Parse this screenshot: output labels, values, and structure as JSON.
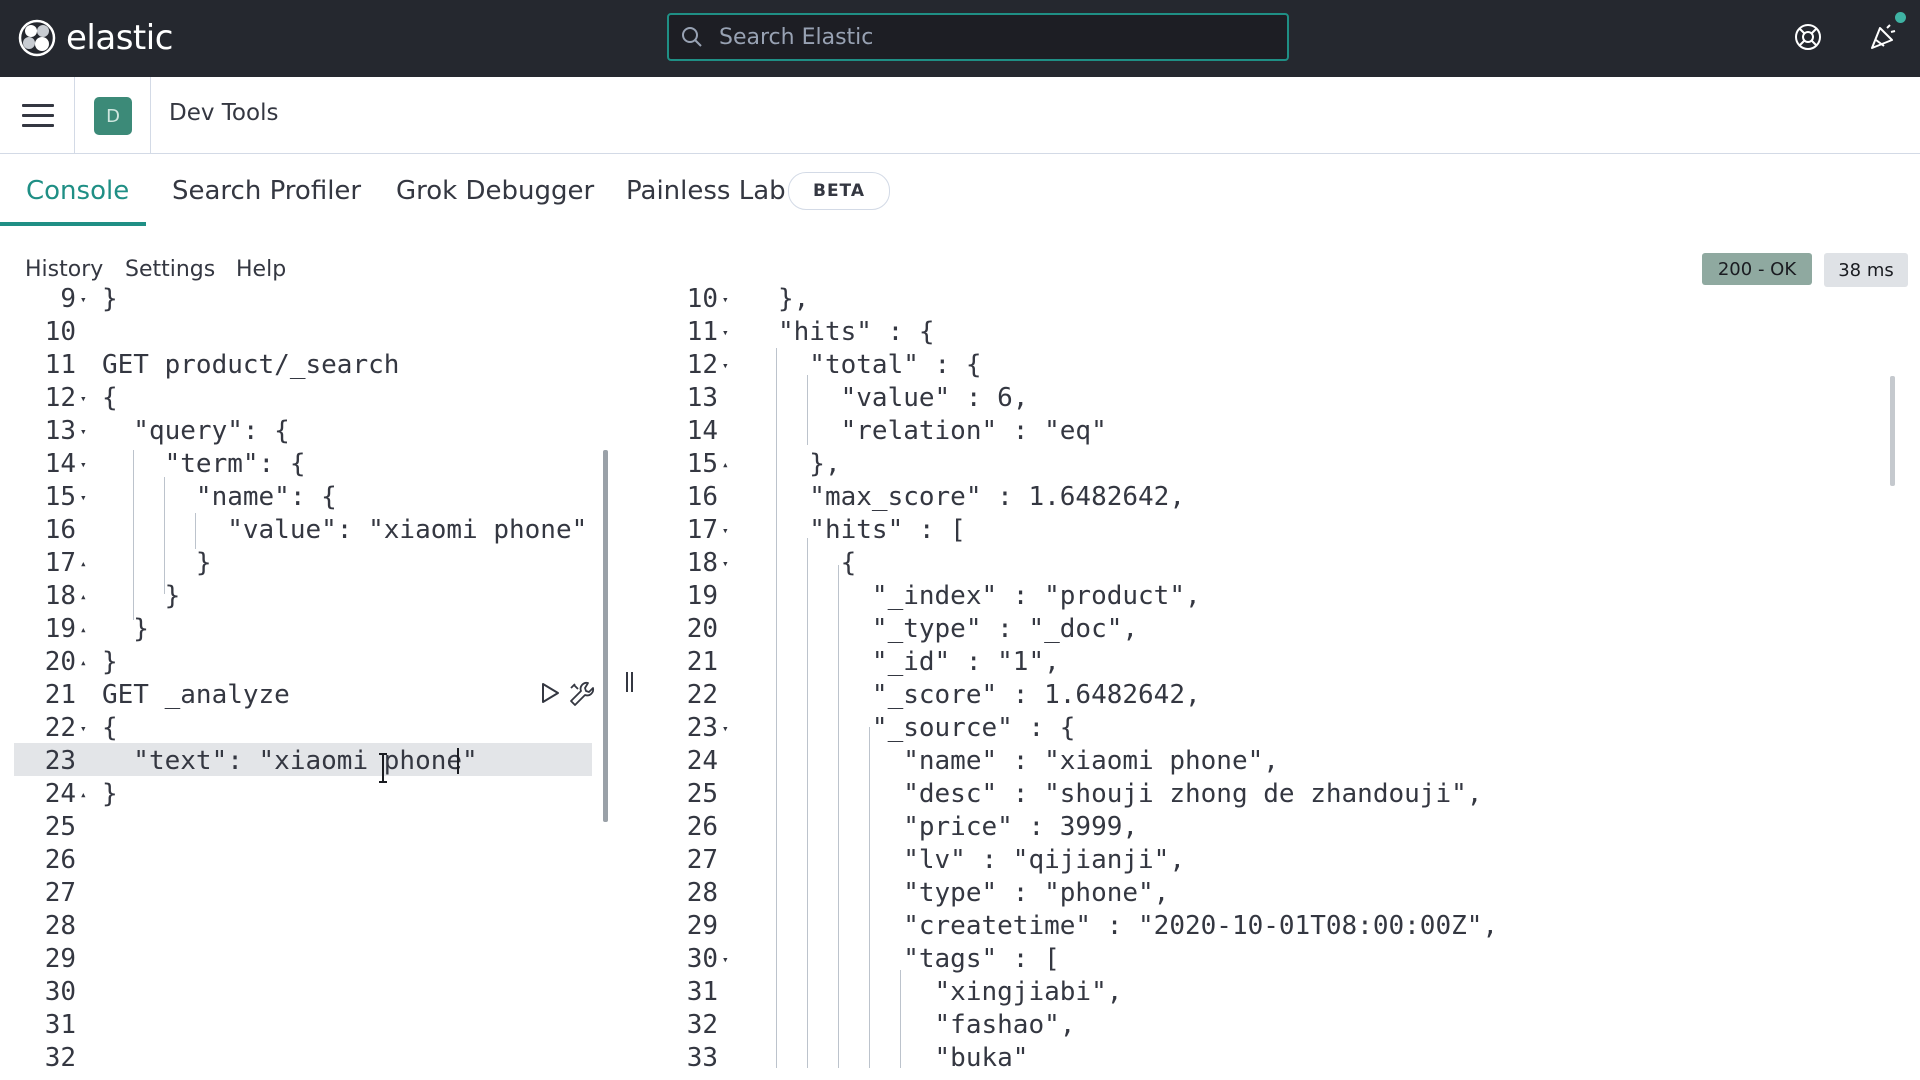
{
  "header": {
    "brand": "elastic",
    "search_placeholder": "Search Elastic"
  },
  "breadcrumb": {
    "space_initial": "D",
    "title": "Dev Tools"
  },
  "tabs": [
    {
      "label": "Console",
      "active": true
    },
    {
      "label": "Search Profiler",
      "active": false
    },
    {
      "label": "Grok Debugger",
      "active": false
    },
    {
      "label": "Painless Lab",
      "active": false
    }
  ],
  "beta_badge": "BETA",
  "console_menu": {
    "history": "History",
    "settings": "Settings",
    "help": "Help"
  },
  "response_status": {
    "status": "200 - OK",
    "time": "38 ms"
  },
  "request_editor": {
    "lines": [
      {
        "n": "9",
        "fold": "▾",
        "text": "}"
      },
      {
        "n": "10",
        "fold": "",
        "text": ""
      },
      {
        "n": "11",
        "fold": "",
        "text": "GET product/_search"
      },
      {
        "n": "12",
        "fold": "▾",
        "text": "{"
      },
      {
        "n": "13",
        "fold": "▾",
        "text": "  \"query\": {"
      },
      {
        "n": "14",
        "fold": "▾",
        "text": "    \"term\": {"
      },
      {
        "n": "15",
        "fold": "▾",
        "text": "      \"name\": {"
      },
      {
        "n": "16",
        "fold": "",
        "text": "        \"value\": \"xiaomi phone\""
      },
      {
        "n": "17",
        "fold": "▴",
        "text": "      }"
      },
      {
        "n": "18",
        "fold": "▴",
        "text": "    }"
      },
      {
        "n": "19",
        "fold": "▴",
        "text": "  }"
      },
      {
        "n": "20",
        "fold": "▴",
        "text": "}"
      },
      {
        "n": "21",
        "fold": "",
        "text": "GET _analyze"
      },
      {
        "n": "22",
        "fold": "▾",
        "text": "{"
      },
      {
        "n": "23",
        "fold": "",
        "text": "  \"text\": \"xiaomi phone\""
      },
      {
        "n": "24",
        "fold": "▴",
        "text": "}"
      },
      {
        "n": "25",
        "fold": "",
        "text": ""
      },
      {
        "n": "26",
        "fold": "",
        "text": ""
      },
      {
        "n": "27",
        "fold": "",
        "text": ""
      },
      {
        "n": "28",
        "fold": "",
        "text": ""
      },
      {
        "n": "29",
        "fold": "",
        "text": ""
      },
      {
        "n": "30",
        "fold": "",
        "text": ""
      },
      {
        "n": "31",
        "fold": "",
        "text": ""
      },
      {
        "n": "32",
        "fold": "",
        "text": ""
      }
    ]
  },
  "response_editor": {
    "lines": [
      {
        "n": "10",
        "fold": "▾",
        "text": "},"
      },
      {
        "n": "11",
        "fold": "▾",
        "text": "\"hits\" : {"
      },
      {
        "n": "12",
        "fold": "▾",
        "text": "  \"total\" : {"
      },
      {
        "n": "13",
        "fold": "",
        "text": "    \"value\" : 6,"
      },
      {
        "n": "14",
        "fold": "",
        "text": "    \"relation\" : \"eq\""
      },
      {
        "n": "15",
        "fold": "▴",
        "text": "  },"
      },
      {
        "n": "16",
        "fold": "",
        "text": "  \"max_score\" : 1.6482642,"
      },
      {
        "n": "17",
        "fold": "▾",
        "text": "  \"hits\" : ["
      },
      {
        "n": "18",
        "fold": "▾",
        "text": "    {"
      },
      {
        "n": "19",
        "fold": "",
        "text": "      \"_index\" : \"product\","
      },
      {
        "n": "20",
        "fold": "",
        "text": "      \"_type\" : \"_doc\","
      },
      {
        "n": "21",
        "fold": "",
        "text": "      \"_id\" : \"1\","
      },
      {
        "n": "22",
        "fold": "",
        "text": "      \"_score\" : 1.6482642,"
      },
      {
        "n": "23",
        "fold": "▾",
        "text": "      \"_source\" : {"
      },
      {
        "n": "24",
        "fold": "",
        "text": "        \"name\" : \"xiaomi phone\","
      },
      {
        "n": "25",
        "fold": "",
        "text": "        \"desc\" : \"shouji zhong de zhandouji\","
      },
      {
        "n": "26",
        "fold": "",
        "text": "        \"price\" : 3999,"
      },
      {
        "n": "27",
        "fold": "",
        "text": "        \"lv\" : \"qijianji\","
      },
      {
        "n": "28",
        "fold": "",
        "text": "        \"type\" : \"phone\","
      },
      {
        "n": "29",
        "fold": "",
        "text": "        \"createtime\" : \"2020-10-01T08:00:00Z\","
      },
      {
        "n": "30",
        "fold": "▾",
        "text": "        \"tags\" : ["
      },
      {
        "n": "31",
        "fold": "",
        "text": "          \"xingjiabi\","
      },
      {
        "n": "32",
        "fold": "",
        "text": "          \"fashao\","
      },
      {
        "n": "33",
        "fold": "",
        "text": "          \"buka\""
      }
    ]
  },
  "icons": {
    "logo": "elastic-logo-icon",
    "search": "search-icon",
    "help": "help-lifebuoy-icon",
    "news": "newsfeed-icon",
    "menu": "hamburger-menu-icon",
    "run": "play-icon",
    "wrench": "wrench-icon"
  },
  "colors": {
    "header_bg": "#25282f",
    "accent": "#1f8f85",
    "status_ok_bg": "#8fa9a0"
  }
}
